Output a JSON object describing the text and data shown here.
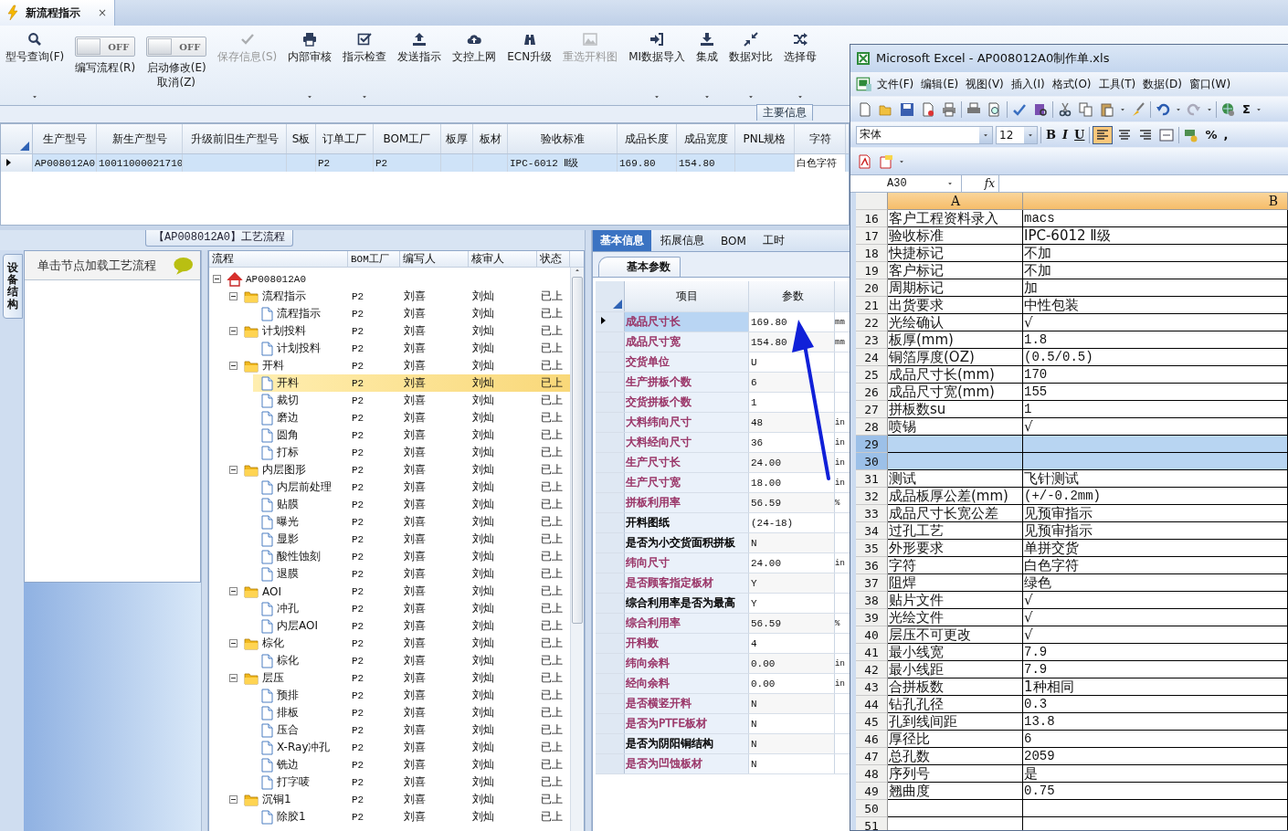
{
  "tab": {
    "title": "新流程指示",
    "close": "×"
  },
  "toolbar": [
    {
      "kind": "button",
      "label": "型号查询(F)",
      "menu": true,
      "disabled": false
    },
    {
      "kind": "toggle",
      "label": "编写流程(R)",
      "on": false,
      "state_text": "OFF"
    },
    {
      "kind": "toggle",
      "label": "启动修改(E)",
      "sub_label": "取消(Z)",
      "on": false,
      "state_text": "OFF"
    },
    {
      "kind": "button",
      "label": "保存信息(S)",
      "menu": false,
      "disabled": true
    },
    {
      "kind": "button",
      "label": "内部审核",
      "menu": true,
      "disabled": false
    },
    {
      "kind": "button",
      "label": "指示检查",
      "menu": true,
      "disabled": false
    },
    {
      "kind": "button",
      "label": "发送指示",
      "menu": false,
      "disabled": false
    },
    {
      "kind": "button",
      "label": "文控上网",
      "menu": false,
      "disabled": false
    },
    {
      "kind": "button",
      "label": "ECN升级",
      "menu": false,
      "disabled": false
    },
    {
      "kind": "button",
      "label": "重选开料图",
      "menu": false,
      "disabled": true
    },
    {
      "kind": "button",
      "label": "MI数据导入",
      "menu": true,
      "disabled": false
    },
    {
      "kind": "button",
      "label": "集成",
      "menu": true,
      "disabled": false
    },
    {
      "kind": "button",
      "label": "数据对比",
      "menu": true,
      "disabled": false
    },
    {
      "kind": "button",
      "label": "选择母",
      "menu": true,
      "disabled": false
    }
  ],
  "section_label": "主要信息",
  "main_grid": {
    "columns": [
      "生产型号",
      "新生产型号",
      "升级前旧生产型号",
      "S板",
      "订单工厂",
      "BOM工厂",
      "板厚",
      "板材",
      "验收标准",
      "成品长度",
      "成品宽度",
      "PNL规格",
      "字符"
    ],
    "rows": [
      {
        "selected": true,
        "cells": [
          "AP008012A0",
          "10011000021710",
          null,
          null,
          "P2",
          "P2",
          null,
          null,
          "IPC-6012 Ⅱ级",
          "169.80",
          "154.80",
          null,
          "白色字符"
        ]
      }
    ]
  },
  "flow_panel": {
    "title": "【AP008012A0】工艺流程",
    "side_tab": "设备结构",
    "hint": "单击节点加载工艺流程",
    "columns": [
      "流程",
      "BOM工厂",
      "编写人",
      "核审人",
      "状态"
    ],
    "tree": {
      "label": "AP008012A0",
      "kind": "home",
      "expanded": true,
      "selected": false,
      "children": [
        {
          "label": "流程指示",
          "kind": "folder",
          "bom": "P2",
          "writer": "刘喜",
          "reviewer": "刘灿",
          "status": "已上",
          "expanded": true,
          "selected": false,
          "children": [
            {
              "label": "流程指示",
              "kind": "file",
              "bom": "P2",
              "writer": "刘喜",
              "reviewer": "刘灿",
              "status": "已上",
              "selected": false
            }
          ]
        },
        {
          "label": "计划投料",
          "kind": "folder",
          "bom": "P2",
          "writer": "刘喜",
          "reviewer": "刘灿",
          "status": "已上",
          "expanded": true,
          "selected": false,
          "children": [
            {
              "label": "计划投料",
              "kind": "file",
              "bom": "P2",
              "writer": "刘喜",
              "reviewer": "刘灿",
              "status": "已上",
              "selected": false
            }
          ]
        },
        {
          "label": "开料",
          "kind": "folder",
          "bom": "P2",
          "writer": "刘喜",
          "reviewer": "刘灿",
          "status": "已上",
          "expanded": true,
          "selected": false,
          "children": [
            {
              "label": "开料",
              "kind": "file",
              "bom": "P2",
              "writer": "刘喜",
              "reviewer": "刘灿",
              "status": "已上",
              "selected": true
            },
            {
              "label": "裁切",
              "kind": "file",
              "bom": "P2",
              "writer": "刘喜",
              "reviewer": "刘灿",
              "status": "已上",
              "selected": false
            },
            {
              "label": "磨边",
              "kind": "file",
              "bom": "P2",
              "writer": "刘喜",
              "reviewer": "刘灿",
              "status": "已上",
              "selected": false
            },
            {
              "label": "圆角",
              "kind": "file",
              "bom": "P2",
              "writer": "刘喜",
              "reviewer": "刘灿",
              "status": "已上",
              "selected": false
            },
            {
              "label": "打标",
              "kind": "file",
              "bom": "P2",
              "writer": "刘喜",
              "reviewer": "刘灿",
              "status": "已上",
              "selected": false
            }
          ]
        },
        {
          "label": "内层图形",
          "kind": "folder",
          "bom": "P2",
          "writer": "刘喜",
          "reviewer": "刘灿",
          "status": "已上",
          "expanded": true,
          "selected": false,
          "children": [
            {
              "label": "内层前处理",
              "kind": "file",
              "bom": "P2",
              "writer": "刘喜",
              "reviewer": "刘灿",
              "status": "已上",
              "selected": false
            },
            {
              "label": "贴膜",
              "kind": "file",
              "bom": "P2",
              "writer": "刘喜",
              "reviewer": "刘灿",
              "status": "已上",
              "selected": false
            },
            {
              "label": "曝光",
              "kind": "file",
              "bom": "P2",
              "writer": "刘喜",
              "reviewer": "刘灿",
              "status": "已上",
              "selected": false
            },
            {
              "label": "显影",
              "kind": "file",
              "bom": "P2",
              "writer": "刘喜",
              "reviewer": "刘灿",
              "status": "已上",
              "selected": false
            },
            {
              "label": "酸性蚀刻",
              "kind": "file",
              "bom": "P2",
              "writer": "刘喜",
              "reviewer": "刘灿",
              "status": "已上",
              "selected": false
            },
            {
              "label": "退膜",
              "kind": "file",
              "bom": "P2",
              "writer": "刘喜",
              "reviewer": "刘灿",
              "status": "已上",
              "selected": false
            }
          ]
        },
        {
          "label": "AOI",
          "kind": "folder",
          "bom": "P2",
          "writer": "刘喜",
          "reviewer": "刘灿",
          "status": "已上",
          "expanded": true,
          "selected": false,
          "children": [
            {
              "label": "冲孔",
              "kind": "file",
              "bom": "P2",
              "writer": "刘喜",
              "reviewer": "刘灿",
              "status": "已上",
              "selected": false
            },
            {
              "label": "内层AOI",
              "kind": "file",
              "bom": "P2",
              "writer": "刘喜",
              "reviewer": "刘灿",
              "status": "已上",
              "selected": false
            }
          ]
        },
        {
          "label": "棕化",
          "kind": "folder",
          "bom": "P2",
          "writer": "刘喜",
          "reviewer": "刘灿",
          "status": "已上",
          "expanded": true,
          "selected": false,
          "children": [
            {
              "label": "棕化",
              "kind": "file",
              "bom": "P2",
              "writer": "刘喜",
              "reviewer": "刘灿",
              "status": "已上",
              "selected": false
            }
          ]
        },
        {
          "label": "层压",
          "kind": "folder",
          "bom": "P2",
          "writer": "刘喜",
          "reviewer": "刘灿",
          "status": "已上",
          "expanded": true,
          "selected": false,
          "children": [
            {
              "label": "预排",
              "kind": "file",
              "bom": "P2",
              "writer": "刘喜",
              "reviewer": "刘灿",
              "status": "已上",
              "selected": false
            },
            {
              "label": "排板",
              "kind": "file",
              "bom": "P2",
              "writer": "刘喜",
              "reviewer": "刘灿",
              "status": "已上",
              "selected": false
            },
            {
              "label": "压合",
              "kind": "file",
              "bom": "P2",
              "writer": "刘喜",
              "reviewer": "刘灿",
              "status": "已上",
              "selected": false
            },
            {
              "label": "X-Ray冲孔",
              "kind": "file",
              "bom": "P2",
              "writer": "刘喜",
              "reviewer": "刘灿",
              "status": "已上",
              "selected": false
            },
            {
              "label": "铣边",
              "kind": "file",
              "bom": "P2",
              "writer": "刘喜",
              "reviewer": "刘灿",
              "status": "已上",
              "selected": false
            },
            {
              "label": "打字唛",
              "kind": "file",
              "bom": "P2",
              "writer": "刘喜",
              "reviewer": "刘灿",
              "status": "已上",
              "selected": false
            }
          ]
        },
        {
          "label": "沉铜1",
          "kind": "folder",
          "bom": "P2",
          "writer": "刘喜",
          "reviewer": "刘灿",
          "status": "已上",
          "expanded": true,
          "selected": false,
          "children": [
            {
              "label": "除胶1",
              "kind": "file",
              "bom": "P2",
              "writer": "刘喜",
              "reviewer": "刘灿",
              "status": "已上",
              "selected": false
            }
          ]
        }
      ]
    }
  },
  "detail_panel": {
    "tabs": [
      {
        "label": "基本信息",
        "selected": true
      },
      {
        "label": "拓展信息",
        "selected": false
      },
      {
        "label": "BOM",
        "selected": false
      },
      {
        "label": "工时",
        "selected": false
      }
    ],
    "subtab": "基本参数",
    "columns": [
      "项目",
      "参数"
    ],
    "rows": [
      {
        "name": "成品尺寸长",
        "value": "169.80",
        "unit": "mm",
        "color": "#993366",
        "selected": true
      },
      {
        "name": "成品尺寸宽",
        "value": "154.80",
        "unit": "mm",
        "color": "#993366",
        "selected": false
      },
      {
        "name": "交货单位",
        "value": "U",
        "color": "#993366",
        "selected": false
      },
      {
        "name": "生产拼板个数",
        "value": "6",
        "color": "#993366",
        "selected": false
      },
      {
        "name": "交货拼板个数",
        "value": "1",
        "color": "#993366",
        "selected": false
      },
      {
        "name": "大料纬向尺寸",
        "value": "48",
        "unit": "in",
        "color": "#993366",
        "selected": false
      },
      {
        "name": "大料经向尺寸",
        "value": "36",
        "unit": "in",
        "color": "#993366",
        "selected": false
      },
      {
        "name": "生产尺寸长",
        "value": "24.00",
        "unit": "in",
        "color": "#993366",
        "selected": false
      },
      {
        "name": "生产尺寸宽",
        "value": "18.00",
        "unit": "in",
        "color": "#993366",
        "selected": false
      },
      {
        "name": "拼板利用率",
        "value": "56.59",
        "unit": "%",
        "color": "#993366",
        "selected": false
      },
      {
        "name": "开料图纸",
        "value": "(24-18)",
        "color": "#000000",
        "selected": false
      },
      {
        "name": "是否为小交货面积拼板",
        "value": "N",
        "color": "#000000",
        "selected": false
      },
      {
        "name": "纬向尺寸",
        "value": "24.00",
        "unit": "in",
        "color": "#993366",
        "selected": false
      },
      {
        "name": "是否顾客指定板材",
        "value": "Y",
        "color": "#993366",
        "selected": false
      },
      {
        "name": "综合利用率是否为最高",
        "value": "Y",
        "color": "#000000",
        "selected": false
      },
      {
        "name": "综合利用率",
        "value": "56.59",
        "unit": "%",
        "color": "#993366",
        "selected": false
      },
      {
        "name": "开料数",
        "value": "4",
        "color": "#993366",
        "selected": false
      },
      {
        "name": "纬向余料",
        "value": "0.00",
        "unit": "in",
        "color": "#993366",
        "selected": false
      },
      {
        "name": "经向余料",
        "value": "0.00",
        "unit": "in",
        "color": "#993366",
        "selected": false
      },
      {
        "name": "是否横竖开料",
        "value": "N",
        "color": "#993366",
        "selected": false
      },
      {
        "name": "是否为PTFE板材",
        "value": "N",
        "color": "#993366",
        "selected": false
      },
      {
        "name": "是否为阴阳铜结构",
        "value": "N",
        "color": "#000000",
        "selected": false
      },
      {
        "name": "是否为凹蚀板材",
        "value": "N",
        "color": "#993366",
        "selected": false
      }
    ]
  },
  "excel": {
    "title": "Microsoft Excel - AP008012A0制作单.xls",
    "menu": [
      "文件(F)",
      "编辑(E)",
      "视图(V)",
      "插入(I)",
      "格式(O)",
      "工具(T)",
      "数据(D)",
      "窗口(W)"
    ],
    "sum": "Σ",
    "font": "宋体",
    "size": "12",
    "format_buttons": [
      "B",
      "I",
      "U"
    ],
    "align_buttons": [
      {
        "selected": true
      },
      {
        "selected": false
      },
      {
        "selected": false
      }
    ],
    "number_buttons": [
      "%",
      ","
    ],
    "name_box": "A30",
    "fx": "fx",
    "columns": [
      {
        "label": "A",
        "selected": true
      },
      {
        "label": "B",
        "selected": true
      }
    ],
    "rows": [
      {
        "num": "16",
        "a": "客户工程资料录入",
        "b": "macs",
        "selected": false
      },
      {
        "num": "17",
        "a": "验收标准",
        "b": "IPC-6012 Ⅱ级",
        "selected": false
      },
      {
        "num": "18",
        "a": "快捷标记",
        "b": "不加",
        "selected": false
      },
      {
        "num": "19",
        "a": "客户标记",
        "b": "不加",
        "selected": false
      },
      {
        "num": "20",
        "a": "周期标记",
        "b": "加",
        "selected": false
      },
      {
        "num": "21",
        "a": "出货要求",
        "b": "中性包装",
        "selected": false
      },
      {
        "num": "22",
        "a": "光绘确认",
        "b": "√",
        "selected": false
      },
      {
        "num": "23",
        "a": "板厚(mm)",
        "b": "1.8",
        "selected": false
      },
      {
        "num": "24",
        "a": "铜箔厚度(OZ)",
        "b": "(0.5/0.5)",
        "selected": false
      },
      {
        "num": "25",
        "a": "成品尺寸长(mm)",
        "b": "170",
        "selected": false
      },
      {
        "num": "26",
        "a": "成品尺寸宽(mm)",
        "b": "155",
        "selected": false
      },
      {
        "num": "27",
        "a": "拼板数su",
        "b": "1",
        "selected": false
      },
      {
        "num": "28",
        "a": "喷锡",
        "b": "√",
        "selected": false
      },
      {
        "num": "29",
        "selected": true
      },
      {
        "num": "30",
        "selected": true
      },
      {
        "num": "31",
        "a": "测试",
        "b": "飞针测试",
        "selected": false
      },
      {
        "num": "32",
        "a": "成品板厚公差(mm)",
        "b": "(+/-0.2mm)",
        "selected": false
      },
      {
        "num": "33",
        "a": "成品尺寸长宽公差",
        "b": "见预审指示",
        "selected": false
      },
      {
        "num": "34",
        "a": "过孔工艺",
        "b": "见预审指示",
        "selected": false
      },
      {
        "num": "35",
        "a": "外形要求",
        "b": "单拼交货",
        "selected": false
      },
      {
        "num": "36",
        "a": "字符",
        "b": "白色字符",
        "selected": false
      },
      {
        "num": "37",
        "a": "阻焊",
        "b": "绿色",
        "selected": false
      },
      {
        "num": "38",
        "a": "贴片文件",
        "b": "√",
        "selected": false
      },
      {
        "num": "39",
        "a": "光绘文件",
        "b": "√",
        "selected": false
      },
      {
        "num": "40",
        "a": "层压不可更改",
        "b": "√",
        "selected": false
      },
      {
        "num": "41",
        "a": "最小线宽",
        "b": "7.9",
        "selected": false
      },
      {
        "num": "42",
        "a": "最小线距",
        "b": "7.9",
        "selected": false
      },
      {
        "num": "43",
        "a": "合拼板数",
        "b": "1种相同",
        "selected": false
      },
      {
        "num": "44",
        "a": "钻孔孔径",
        "b": "0.3",
        "selected": false
      },
      {
        "num": "45",
        "a": "孔到线间距",
        "b": "13.8",
        "selected": false
      },
      {
        "num": "46",
        "a": "厚径比",
        "b": "6",
        "selected": false
      },
      {
        "num": "47",
        "a": "总孔数",
        "b": "2059",
        "selected": false
      },
      {
        "num": "48",
        "a": "序列号",
        "b": "是",
        "selected": false
      },
      {
        "num": "49",
        "a": "翘曲度",
        "b": "0.75",
        "selected": false
      },
      {
        "num": "50",
        "selected": false
      },
      {
        "num": "51",
        "selected": false
      }
    ]
  }
}
